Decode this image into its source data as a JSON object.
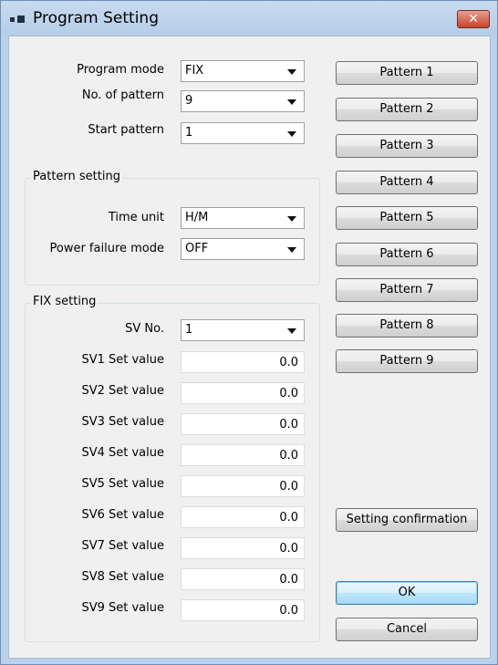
{
  "window": {
    "title": "Program Setting",
    "close_glyph": "✕"
  },
  "program": {
    "mode_label": "Program mode",
    "mode_value": "FIX",
    "patterns_label": "No. of pattern",
    "patterns_value": "9",
    "start_label": "Start pattern",
    "start_value": "1"
  },
  "pattern_setting": {
    "title": "Pattern setting",
    "time_unit_label": "Time unit",
    "time_unit_value": "H/M",
    "power_failure_label": "Power failure mode",
    "power_failure_value": "OFF"
  },
  "fix_setting": {
    "title": "FIX setting",
    "sv_no_label": "SV No.",
    "sv_no_value": "1",
    "set_values": [
      {
        "label": "SV1 Set value",
        "value": "0.0"
      },
      {
        "label": "SV2 Set value",
        "value": "0.0"
      },
      {
        "label": "SV3 Set value",
        "value": "0.0"
      },
      {
        "label": "SV4 Set value",
        "value": "0.0"
      },
      {
        "label": "SV5 Set value",
        "value": "0.0"
      },
      {
        "label": "SV6 Set value",
        "value": "0.0"
      },
      {
        "label": "SV7 Set value",
        "value": "0.0"
      },
      {
        "label": "SV8 Set value",
        "value": "0.0"
      },
      {
        "label": "SV9 Set value",
        "value": "0.0"
      }
    ]
  },
  "pattern_buttons": [
    "Pattern 1",
    "Pattern 2",
    "Pattern 3",
    "Pattern 4",
    "Pattern 5",
    "Pattern 6",
    "Pattern 7",
    "Pattern 8",
    "Pattern 9"
  ],
  "actions": {
    "confirm_label": "Setting confirmation",
    "ok_label": "OK",
    "cancel_label": "Cancel"
  },
  "icons": {
    "app": "app-window-icon",
    "close": "close-icon",
    "dropdown": "chevron-down-icon"
  }
}
